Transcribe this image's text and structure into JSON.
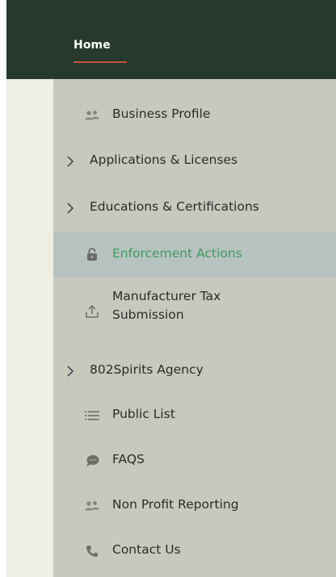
{
  "header": {
    "home_label": "Home",
    "accent_color": "#c8553a",
    "background_color": "#25392d"
  },
  "menu": {
    "items": [
      {
        "label": "Business Profile",
        "icon": "people-icon",
        "expandable": false,
        "active": false
      },
      {
        "label": "Applications & Licenses",
        "icon": "chevron-right-icon",
        "expandable": true,
        "active": false
      },
      {
        "label": "Educations & Certifications",
        "icon": "chevron-right-icon",
        "expandable": true,
        "active": false
      },
      {
        "label": "Enforcement Actions",
        "icon": "lock-icon",
        "expandable": false,
        "active": true
      },
      {
        "label": "Manufacturer Tax Submission",
        "icon": "upload-icon",
        "expandable": false,
        "active": false
      },
      {
        "label": "802Spirits Agency",
        "icon": "chevron-right-icon",
        "expandable": true,
        "active": false
      },
      {
        "label": "Public List",
        "icon": "list-icon",
        "expandable": false,
        "active": false
      },
      {
        "label": "FAQS",
        "icon": "chat-bubble-icon",
        "expandable": false,
        "active": false
      },
      {
        "label": "Non Profit Reporting",
        "icon": "people-icon",
        "expandable": false,
        "active": false
      },
      {
        "label": "Contact Us",
        "icon": "phone-icon",
        "expandable": false,
        "active": false
      }
    ],
    "active_text_color": "#3f9a60",
    "active_background_color": "#b7c3c0",
    "background_color": "#c8c9bc"
  }
}
